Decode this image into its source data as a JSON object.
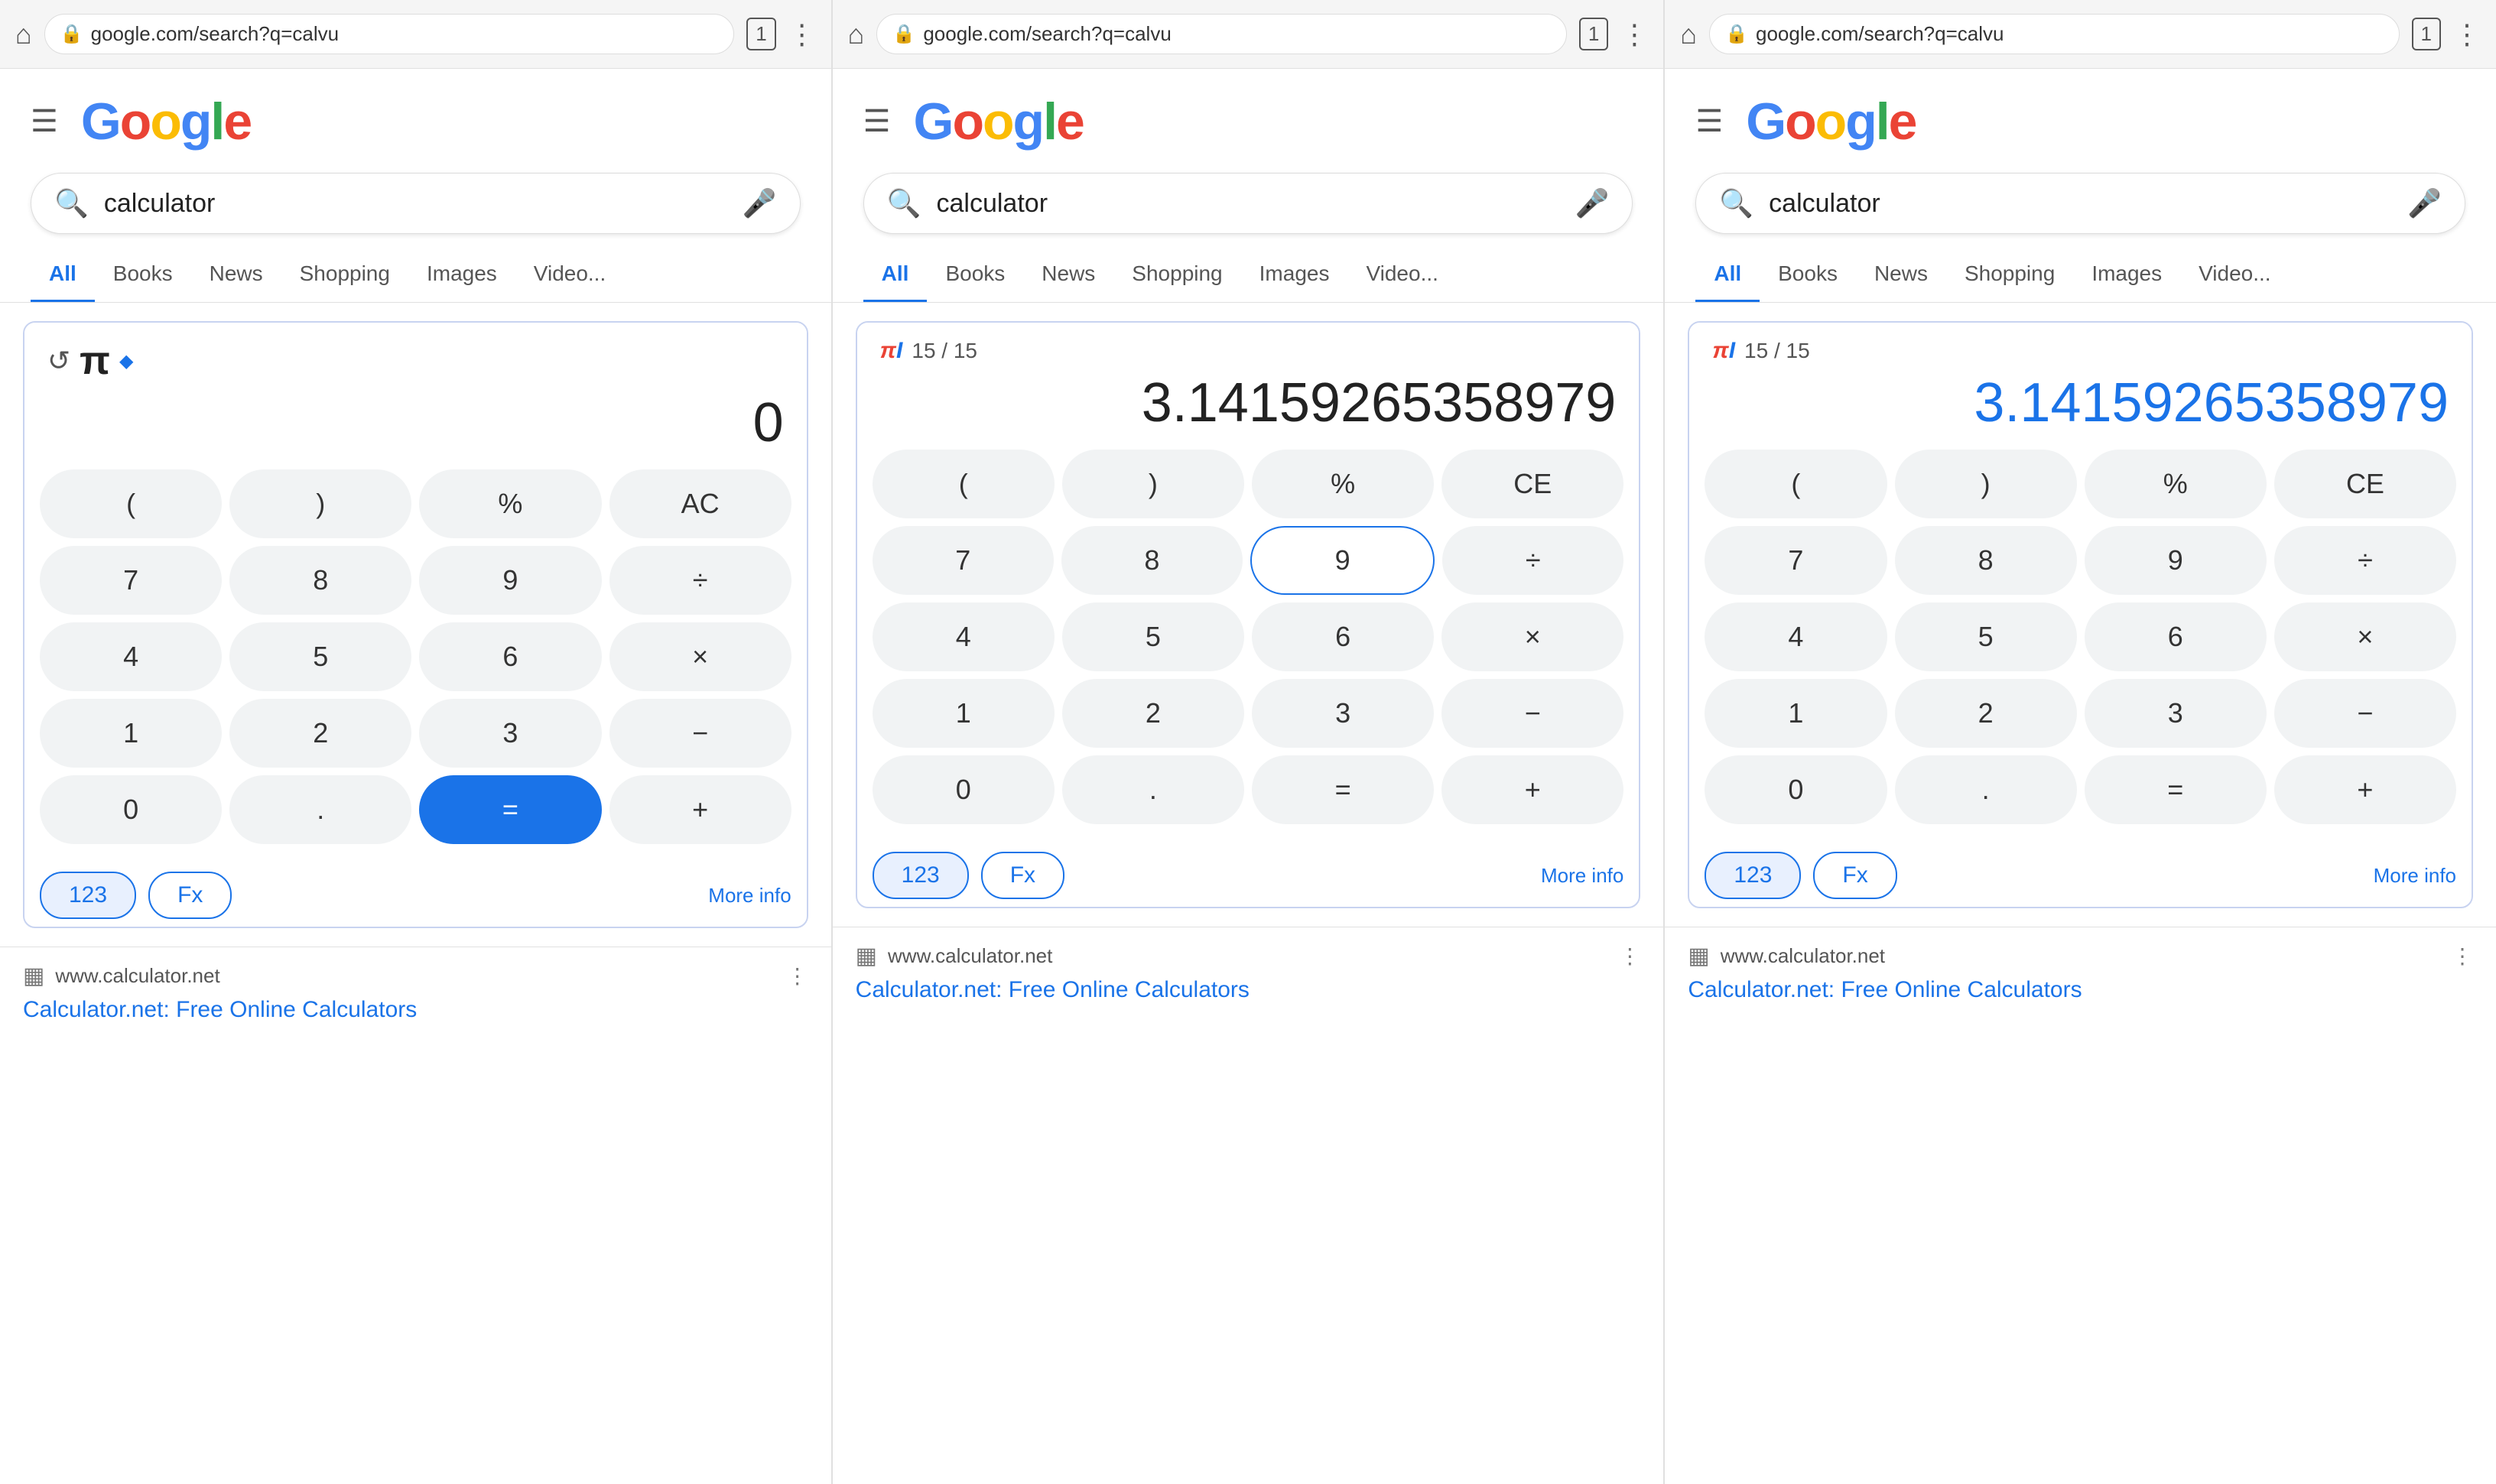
{
  "panels": [
    {
      "id": "panel1",
      "browser": {
        "url": "google.com/search?q=calvu",
        "tab_count": "1"
      },
      "google": {
        "search_query": "calculator"
      },
      "tabs": [
        "All",
        "Books",
        "News",
        "Shopping",
        "Images",
        "Video..."
      ],
      "active_tab": "All",
      "calculator": {
        "show_pi_header": false,
        "show_history": true,
        "show_pi_symbol": true,
        "show_diamond": true,
        "fraction": "",
        "display_value": "0",
        "display_blue": false,
        "buttons": [
          [
            "(",
            ")",
            "%",
            "AC"
          ],
          [
            "7",
            "8",
            "9",
            "÷"
          ],
          [
            "4",
            "5",
            "6",
            "×"
          ],
          [
            "1",
            "2",
            "3",
            "−"
          ],
          [
            "0",
            ".",
            "=",
            "+"
          ]
        ],
        "equals_blue": true,
        "highlighted_btn": null,
        "mode_123": "123",
        "mode_fx": "Fx"
      },
      "result": {
        "domain": "www.calculator.net",
        "title": "Calculator.net: Free Online Calculators"
      }
    },
    {
      "id": "panel2",
      "browser": {
        "url": "google.com/search?q=calvu",
        "tab_count": "1"
      },
      "google": {
        "search_query": "calculator"
      },
      "tabs": [
        "All",
        "Books",
        "News",
        "Shopping",
        "Images",
        "Video..."
      ],
      "active_tab": "All",
      "calculator": {
        "show_pi_header": true,
        "fraction": "15 / 15",
        "display_value": "3.14159265358979",
        "display_blue": false,
        "buttons": [
          [
            "(",
            ")",
            "%",
            "CE"
          ],
          [
            "7",
            "8",
            "9",
            "÷"
          ],
          [
            "4",
            "5",
            "6",
            "×"
          ],
          [
            "1",
            "2",
            "3",
            "−"
          ],
          [
            "0",
            ".",
            "=",
            "+"
          ]
        ],
        "equals_blue": false,
        "highlighted_btn": "9",
        "mode_123": "123",
        "mode_fx": "Fx"
      },
      "result": {
        "domain": "www.calculator.net",
        "title": "Calculator.net: Free Online Calculators"
      }
    },
    {
      "id": "panel3",
      "browser": {
        "url": "google.com/search?q=calvu",
        "tab_count": "1"
      },
      "google": {
        "search_query": "calculator"
      },
      "tabs": [
        "All",
        "Books",
        "News",
        "Shopping",
        "Images",
        "Video..."
      ],
      "active_tab": "All",
      "calculator": {
        "show_pi_header": true,
        "fraction": "15 / 15",
        "display_value": "3.14159265358979",
        "display_blue": true,
        "buttons": [
          [
            "(",
            ")",
            "%",
            "CE"
          ],
          [
            "7",
            "8",
            "9",
            "÷"
          ],
          [
            "4",
            "5",
            "6",
            "×"
          ],
          [
            "1",
            "2",
            "3",
            "−"
          ],
          [
            "0",
            ".",
            "=",
            "+"
          ]
        ],
        "equals_blue": false,
        "highlighted_btn": null,
        "mode_123": "123",
        "mode_fx": "Fx"
      },
      "result": {
        "domain": "www.calculator.net",
        "title": "Calculator.net: Free Online Calculators"
      }
    }
  ],
  "labels": {
    "home": "⌂",
    "lock": "🔒",
    "menu_dots": "⋮",
    "hamburger": "☰",
    "search": "🔍",
    "mic": "🎤",
    "more_info": "More info",
    "favicon": "▦"
  }
}
